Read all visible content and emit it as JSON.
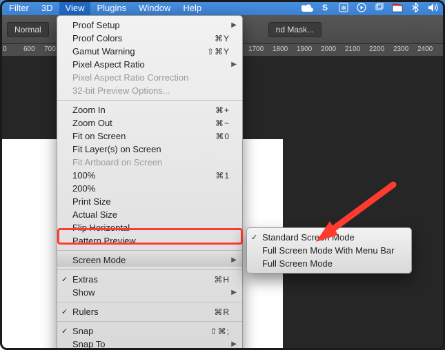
{
  "menubar": {
    "items": [
      "Filter",
      "3D",
      "View",
      "Plugins",
      "Window",
      "Help"
    ],
    "active_index": 2
  },
  "toolbar": {
    "mode_label": "Normal",
    "mask_label": "nd Mask..."
  },
  "ruler": {
    "ticks": [
      "0",
      "600",
      "700",
      "1700",
      "1800",
      "1900",
      "2000",
      "2100",
      "2200",
      "2300",
      "2400"
    ]
  },
  "view_menu": {
    "groups": [
      [
        {
          "label": "Proof Setup",
          "shortcut": "",
          "sub": true
        },
        {
          "label": "Proof Colors",
          "shortcut": "⌘Y"
        },
        {
          "label": "Gamut Warning",
          "shortcut": "⇧⌘Y"
        },
        {
          "label": "Pixel Aspect Ratio",
          "shortcut": "",
          "sub": true
        },
        {
          "label": "Pixel Aspect Ratio Correction",
          "shortcut": "",
          "disabled": true
        },
        {
          "label": "32-bit Preview Options...",
          "shortcut": "",
          "disabled": true
        }
      ],
      [
        {
          "label": "Zoom In",
          "shortcut": "⌘+"
        },
        {
          "label": "Zoom Out",
          "shortcut": "⌘−"
        },
        {
          "label": "Fit on Screen",
          "shortcut": "⌘0"
        },
        {
          "label": "Fit Layer(s) on Screen",
          "shortcut": ""
        },
        {
          "label": "Fit Artboard on Screen",
          "shortcut": "",
          "disabled": true
        },
        {
          "label": "100%",
          "shortcut": "⌘1"
        },
        {
          "label": "200%",
          "shortcut": ""
        },
        {
          "label": "Print Size",
          "shortcut": ""
        },
        {
          "label": "Actual Size",
          "shortcut": ""
        },
        {
          "label": "Flip Horizontal",
          "shortcut": ""
        },
        {
          "label": "Pattern Preview",
          "shortcut": ""
        }
      ],
      [
        {
          "label": "Screen Mode",
          "shortcut": "",
          "sub": true,
          "hi": true
        }
      ],
      [
        {
          "label": "Extras",
          "shortcut": "⌘H",
          "checked": true
        },
        {
          "label": "Show",
          "shortcut": "",
          "sub": true
        }
      ],
      [
        {
          "label": "Rulers",
          "shortcut": "⌘R",
          "checked": true
        }
      ],
      [
        {
          "label": "Snap",
          "shortcut": "⇧⌘;",
          "checked": true
        },
        {
          "label": "Snap To",
          "shortcut": "",
          "sub": true
        }
      ]
    ]
  },
  "screen_mode_submenu": {
    "items": [
      {
        "label": "Standard Screen Mode",
        "checked": true
      },
      {
        "label": "Full Screen Mode With Menu Bar"
      },
      {
        "label": "Full Screen Mode"
      }
    ]
  }
}
